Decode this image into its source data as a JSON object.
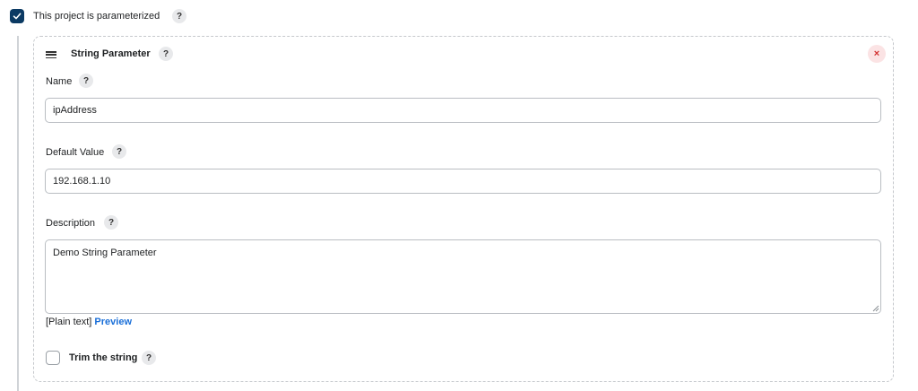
{
  "header": {
    "checkbox_label": "This project is parameterized",
    "checked": true
  },
  "parameter": {
    "type_title": "String Parameter",
    "close_symbol": "×",
    "name": {
      "label": "Name",
      "value": "ipAddress"
    },
    "default_value": {
      "label": "Default Value",
      "value": "192.168.1.10"
    },
    "description": {
      "label": "Description",
      "value": "Demo String Parameter",
      "format_note": "[Plain text]",
      "preview_link": "Preview"
    },
    "trim": {
      "label": "Trim the string",
      "checked": false
    }
  },
  "help_symbol": "?",
  "icons": {
    "checkbox_checked": "check-icon",
    "drag": "drag-handle-icon",
    "close": "close-icon",
    "help": "help-icon",
    "resize": "resize-grip-icon"
  },
  "colors": {
    "checkbox": "#0b3a63",
    "link": "#1a6fd8",
    "close_bg": "#fbe3e4",
    "close_fg": "#d32f2f"
  }
}
